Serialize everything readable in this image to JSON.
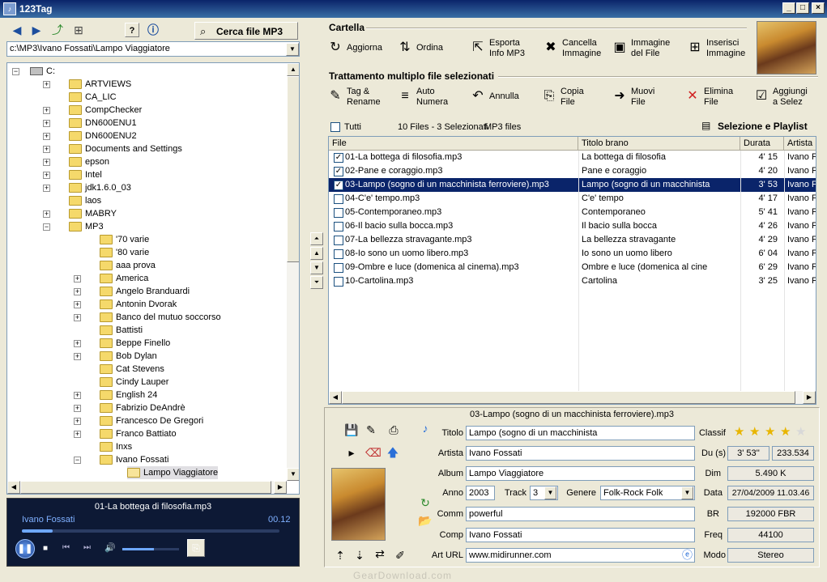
{
  "window": {
    "title": "123Tag"
  },
  "left_toolbar": {
    "search_mp3_label": "Cerca file MP3"
  },
  "path": {
    "value": "c:\\MP3\\Ivano Fossati\\Lampo Viaggiatore"
  },
  "tree": {
    "root": "C:",
    "nodes": [
      {
        "label": "ARTVIEWS",
        "expander": "+"
      },
      {
        "label": "CA_LIC",
        "expander": ""
      },
      {
        "label": "CompChecker",
        "expander": "+"
      },
      {
        "label": "DN600ENU1",
        "expander": "+"
      },
      {
        "label": "DN600ENU2",
        "expander": "+"
      },
      {
        "label": "Documents and Settings",
        "expander": "+"
      },
      {
        "label": "epson",
        "expander": "+"
      },
      {
        "label": "Intel",
        "expander": "+"
      },
      {
        "label": "jdk1.6.0_03",
        "expander": "+"
      },
      {
        "label": "laos",
        "expander": ""
      },
      {
        "label": "MABRY",
        "expander": "+"
      },
      {
        "label": "MP3",
        "expander": "-"
      }
    ],
    "mp3_children": [
      {
        "label": "'70 varie",
        "expander": ""
      },
      {
        "label": "'80 varie",
        "expander": ""
      },
      {
        "label": "aaa prova",
        "expander": ""
      },
      {
        "label": "America",
        "expander": "+"
      },
      {
        "label": "Angelo Branduardi",
        "expander": "+"
      },
      {
        "label": "Antonin Dvorak",
        "expander": "+"
      },
      {
        "label": "Banco del mutuo soccorso",
        "expander": "+"
      },
      {
        "label": "Battisti",
        "expander": ""
      },
      {
        "label": "Beppe Finello",
        "expander": "+"
      },
      {
        "label": "Bob Dylan",
        "expander": "+"
      },
      {
        "label": "Cat Stevens",
        "expander": ""
      },
      {
        "label": "Cindy Lauper",
        "expander": ""
      },
      {
        "label": "English 24",
        "expander": "+"
      },
      {
        "label": "Fabrizio DeAndrè",
        "expander": "+"
      },
      {
        "label": "Francesco De Gregori",
        "expander": "+"
      },
      {
        "label": "Franco Battiato",
        "expander": "+"
      },
      {
        "label": "Inxs",
        "expander": ""
      },
      {
        "label": "Ivano Fossati",
        "expander": "-"
      }
    ],
    "selected_child": "Lampo Viaggiatore"
  },
  "player": {
    "track": "01-La bottega di filosofia.mp3",
    "artist": "Ivano Fossati",
    "time": "00.12",
    "progress": 0.12,
    "volume": 0.55
  },
  "cartella": {
    "title": "Cartella",
    "buttons": [
      {
        "l1": "Aggiorna",
        "l2": ""
      },
      {
        "l1": "Ordina",
        "l2": ""
      },
      {
        "l1": "Esporta",
        "l2": "Info MP3"
      },
      {
        "l1": "Cancella",
        "l2": "Immagine"
      },
      {
        "l1": "Immagine",
        "l2": "del File"
      },
      {
        "l1": "Inserisci",
        "l2": "Immagine"
      }
    ]
  },
  "multi": {
    "title": "Trattamento multiplo file selezionati",
    "buttons": [
      {
        "l1": "Tag &",
        "l2": "Rename"
      },
      {
        "l1": "Auto",
        "l2": "Numera"
      },
      {
        "l1": "Annulla",
        "l2": ""
      },
      {
        "l1": "Copia",
        "l2": "File"
      },
      {
        "l1": "Muovi",
        "l2": "File"
      },
      {
        "l1": "Elimina",
        "l2": "File"
      },
      {
        "l1": "Aggiungi",
        "l2": "a Selez"
      }
    ]
  },
  "filelist": {
    "all_label": "Tutti",
    "count_label": "10 Files - 3 Selezionati",
    "filter_label": "MP3 files",
    "playlist_label": "Selezione e Playlist",
    "columns": [
      "File",
      "Titolo brano",
      "Durata",
      "Artista"
    ],
    "rows": [
      {
        "checked": true,
        "selected": false,
        "file": "01-La bottega di filosofia.mp3",
        "title": "La bottega di filosofia",
        "dur": "4' 15",
        "artist": "Ivano F"
      },
      {
        "checked": true,
        "selected": false,
        "file": "02-Pane e coraggio.mp3",
        "title": "Pane e coraggio",
        "dur": "4' 20",
        "artist": "Ivano F"
      },
      {
        "checked": true,
        "selected": true,
        "file": "03-Lampo (sogno di un macchinista ferroviere).mp3",
        "title": "Lampo (sogno di un macchinista",
        "dur": "3' 53",
        "artist": "Ivano F"
      },
      {
        "checked": false,
        "selected": false,
        "file": "04-C'e' tempo.mp3",
        "title": "C'e' tempo",
        "dur": "4' 17",
        "artist": "Ivano F"
      },
      {
        "checked": false,
        "selected": false,
        "file": "05-Contemporaneo.mp3",
        "title": "Contemporaneo",
        "dur": "5' 41",
        "artist": "Ivano F"
      },
      {
        "checked": false,
        "selected": false,
        "file": "06-Il bacio sulla bocca.mp3",
        "title": "Il bacio sulla bocca",
        "dur": "4' 26",
        "artist": "Ivano F"
      },
      {
        "checked": false,
        "selected": false,
        "file": "07-La bellezza stravagante.mp3",
        "title": "La bellezza stravagante",
        "dur": "4' 29",
        "artist": "Ivano F"
      },
      {
        "checked": false,
        "selected": false,
        "file": "08-Io sono un uomo libero.mp3",
        "title": "Io sono un uomo libero",
        "dur": "6' 04",
        "artist": "Ivano F"
      },
      {
        "checked": false,
        "selected": false,
        "file": "09-Ombre e luce (domenica al cinema).mp3",
        "title": "Ombre e luce (domenica al cine",
        "dur": "6' 29",
        "artist": "Ivano F"
      },
      {
        "checked": false,
        "selected": false,
        "file": "10-Cartolina.mp3",
        "title": "Cartolina",
        "dur": "3' 25",
        "artist": "Ivano F"
      }
    ]
  },
  "detail": {
    "filename": "03-Lampo (sogno di un macchinista ferroviere).mp3",
    "labels": {
      "titolo": "Titolo",
      "artista": "Artista",
      "album": "Album",
      "anno": "Anno",
      "track": "Track",
      "genere": "Genere",
      "comm": "Comm",
      "comp": "Comp",
      "arturl": "Art URL",
      "classif": "Classif",
      "du": "Du (s)",
      "dim": "Dim",
      "data": "Data",
      "br": "BR",
      "freq": "Freq",
      "modo": "Modo"
    },
    "titolo": "Lampo (sogno di un macchinista",
    "artista": "Ivano Fossati",
    "album": "Lampo Viaggiatore",
    "anno": "2003",
    "track": "3",
    "genere": "Folk-Rock Folk",
    "comm": "powerful",
    "comp": "Ivano Fossati",
    "arturl": "www.midirunner.com",
    "rating": 4,
    "du_min": "3' 53''",
    "du_sec": "233.534",
    "dim": "5.490 K",
    "data": "27/04/2009 11.03.46",
    "br": "192000   FBR",
    "freq": "44100",
    "modo": "Stereo"
  },
  "watermark": "GearDownload.com"
}
